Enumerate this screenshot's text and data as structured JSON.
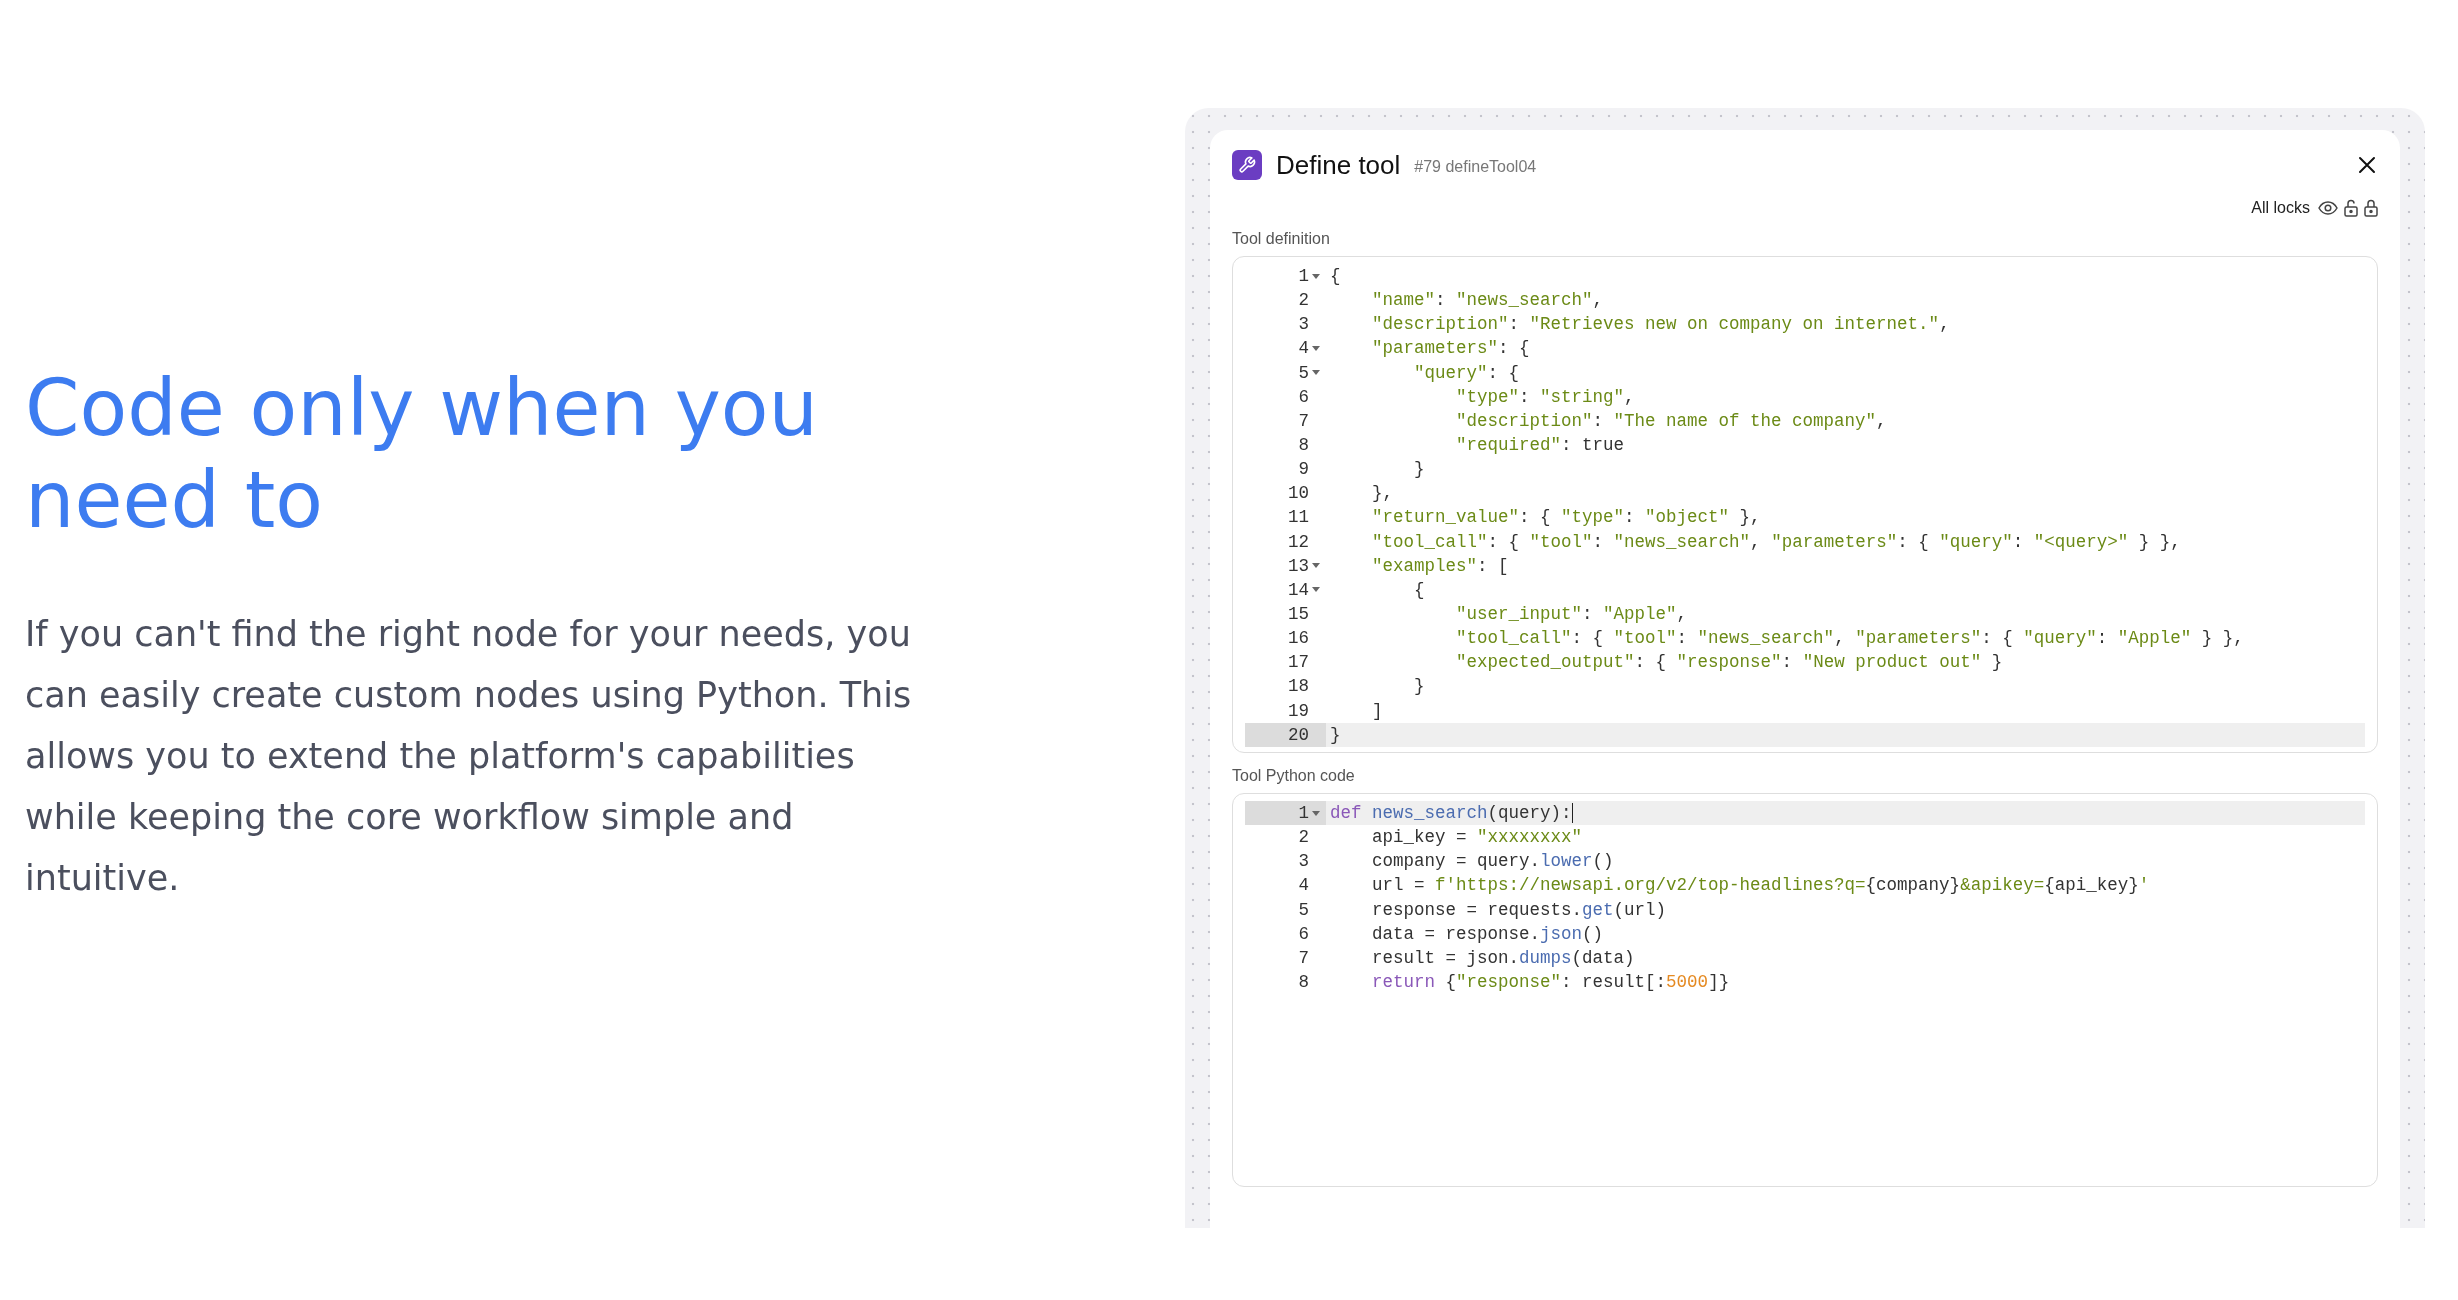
{
  "hero": {
    "heading": "Code only when you need to",
    "body": "If you can't find the right node for your needs, you can easily create custom nodes using Python. This allows you to extend the platform's capabilities while keeping the core workflow simple and intuitive."
  },
  "dialog": {
    "title": "Define tool",
    "subtitle": "#79 defineTool04",
    "locks_label": "All locks",
    "editors": [
      {
        "label": "Tool definition",
        "lines": [
          {
            "number": "1",
            "foldable": true,
            "active": false,
            "cursor": false,
            "tokens": [
              {
                "kind": "plain",
                "text": "{"
              }
            ]
          },
          {
            "number": "2",
            "foldable": false,
            "active": false,
            "cursor": false,
            "tokens": [
              {
                "kind": "string",
                "text": "    \"name\""
              },
              {
                "kind": "plain",
                "text": ": "
              },
              {
                "kind": "string",
                "text": "\"news_search\""
              },
              {
                "kind": "plain",
                "text": ","
              }
            ]
          },
          {
            "number": "3",
            "foldable": false,
            "active": false,
            "cursor": false,
            "tokens": [
              {
                "kind": "string",
                "text": "    \"description\""
              },
              {
                "kind": "plain",
                "text": ": "
              },
              {
                "kind": "string",
                "text": "\"Retrieves new on company on internet.\""
              },
              {
                "kind": "plain",
                "text": ","
              }
            ]
          },
          {
            "number": "4",
            "foldable": true,
            "active": false,
            "cursor": false,
            "tokens": [
              {
                "kind": "string",
                "text": "    \"parameters\""
              },
              {
                "kind": "plain",
                "text": ": {"
              }
            ]
          },
          {
            "number": "5",
            "foldable": true,
            "active": false,
            "cursor": false,
            "tokens": [
              {
                "kind": "string",
                "text": "        \"query\""
              },
              {
                "kind": "plain",
                "text": ": {"
              }
            ]
          },
          {
            "number": "6",
            "foldable": false,
            "active": false,
            "cursor": false,
            "tokens": [
              {
                "kind": "string",
                "text": "            \"type\""
              },
              {
                "kind": "plain",
                "text": ": "
              },
              {
                "kind": "string",
                "text": "\"string\""
              },
              {
                "kind": "plain",
                "text": ","
              }
            ]
          },
          {
            "number": "7",
            "foldable": false,
            "active": false,
            "cursor": false,
            "tokens": [
              {
                "kind": "string",
                "text": "            \"description\""
              },
              {
                "kind": "plain",
                "text": ": "
              },
              {
                "kind": "string",
                "text": "\"The name of the company\""
              },
              {
                "kind": "plain",
                "text": ","
              }
            ]
          },
          {
            "number": "8",
            "foldable": false,
            "active": false,
            "cursor": false,
            "tokens": [
              {
                "kind": "string",
                "text": "            \"required\""
              },
              {
                "kind": "plain",
                "text": ": true"
              }
            ]
          },
          {
            "number": "9",
            "foldable": false,
            "active": false,
            "cursor": false,
            "tokens": [
              {
                "kind": "plain",
                "text": "        }"
              }
            ]
          },
          {
            "number": "10",
            "foldable": false,
            "active": false,
            "cursor": false,
            "tokens": [
              {
                "kind": "plain",
                "text": "    },"
              }
            ]
          },
          {
            "number": "11",
            "foldable": false,
            "active": false,
            "cursor": false,
            "tokens": [
              {
                "kind": "string",
                "text": "    \"return_value\""
              },
              {
                "kind": "plain",
                "text": ": { "
              },
              {
                "kind": "string",
                "text": "\"type\""
              },
              {
                "kind": "plain",
                "text": ": "
              },
              {
                "kind": "string",
                "text": "\"object\""
              },
              {
                "kind": "plain",
                "text": " },"
              }
            ]
          },
          {
            "number": "12",
            "foldable": false,
            "active": false,
            "cursor": false,
            "tokens": [
              {
                "kind": "string",
                "text": "    \"tool_call\""
              },
              {
                "kind": "plain",
                "text": ": { "
              },
              {
                "kind": "string",
                "text": "\"tool\""
              },
              {
                "kind": "plain",
                "text": ": "
              },
              {
                "kind": "string",
                "text": "\"news_search\""
              },
              {
                "kind": "plain",
                "text": ", "
              },
              {
                "kind": "string",
                "text": "\"parameters\""
              },
              {
                "kind": "plain",
                "text": ": { "
              },
              {
                "kind": "string",
                "text": "\"query\""
              },
              {
                "kind": "plain",
                "text": ": "
              },
              {
                "kind": "string",
                "text": "\"<query>\""
              },
              {
                "kind": "plain",
                "text": " } },"
              }
            ]
          },
          {
            "number": "13",
            "foldable": true,
            "active": false,
            "cursor": false,
            "tokens": [
              {
                "kind": "string",
                "text": "    \"examples\""
              },
              {
                "kind": "plain",
                "text": ": ["
              }
            ]
          },
          {
            "number": "14",
            "foldable": true,
            "active": false,
            "cursor": false,
            "tokens": [
              {
                "kind": "plain",
                "text": "        {"
              }
            ]
          },
          {
            "number": "15",
            "foldable": false,
            "active": false,
            "cursor": false,
            "tokens": [
              {
                "kind": "string",
                "text": "            \"user_input\""
              },
              {
                "kind": "plain",
                "text": ": "
              },
              {
                "kind": "string",
                "text": "\"Apple\""
              },
              {
                "kind": "plain",
                "text": ","
              }
            ]
          },
          {
            "number": "16",
            "foldable": false,
            "active": false,
            "cursor": false,
            "tokens": [
              {
                "kind": "string",
                "text": "            \"tool_call\""
              },
              {
                "kind": "plain",
                "text": ": { "
              },
              {
                "kind": "string",
                "text": "\"tool\""
              },
              {
                "kind": "plain",
                "text": ": "
              },
              {
                "kind": "string",
                "text": "\"news_search\""
              },
              {
                "kind": "plain",
                "text": ", "
              },
              {
                "kind": "string",
                "text": "\"parameters\""
              },
              {
                "kind": "plain",
                "text": ": { "
              },
              {
                "kind": "string",
                "text": "\"query\""
              },
              {
                "kind": "plain",
                "text": ": "
              },
              {
                "kind": "string",
                "text": "\"Apple\""
              },
              {
                "kind": "plain",
                "text": " } },"
              }
            ]
          },
          {
            "number": "17",
            "foldable": false,
            "active": false,
            "cursor": false,
            "tokens": [
              {
                "kind": "string",
                "text": "            \"expected_output\""
              },
              {
                "kind": "plain",
                "text": ": { "
              },
              {
                "kind": "string",
                "text": "\"response\""
              },
              {
                "kind": "plain",
                "text": ": "
              },
              {
                "kind": "string",
                "text": "\"New product out\""
              },
              {
                "kind": "plain",
                "text": " }"
              }
            ]
          },
          {
            "number": "18",
            "foldable": false,
            "active": false,
            "cursor": false,
            "tokens": [
              {
                "kind": "plain",
                "text": "        }"
              }
            ]
          },
          {
            "number": "19",
            "foldable": false,
            "active": false,
            "cursor": false,
            "tokens": [
              {
                "kind": "plain",
                "text": "    ]"
              }
            ]
          },
          {
            "number": "20",
            "foldable": false,
            "active": true,
            "cursor": false,
            "tokens": [
              {
                "kind": "plain",
                "text": "}"
              }
            ]
          }
        ]
      },
      {
        "label": "Tool Python code",
        "lines": [
          {
            "number": "1",
            "foldable": true,
            "active": true,
            "cursor": true,
            "tokens": [
              {
                "kind": "keyword",
                "text": "def "
              },
              {
                "kind": "function",
                "text": "news_search"
              },
              {
                "kind": "plain",
                "text": "(query):"
              }
            ]
          },
          {
            "number": "2",
            "foldable": false,
            "active": false,
            "cursor": false,
            "tokens": [
              {
                "kind": "plain",
                "text": "    api_key = "
              },
              {
                "kind": "string",
                "text": "\"xxxxxxxx\""
              }
            ]
          },
          {
            "number": "3",
            "foldable": false,
            "active": false,
            "cursor": false,
            "tokens": [
              {
                "kind": "plain",
                "text": "    company = query."
              },
              {
                "kind": "function",
                "text": "lower"
              },
              {
                "kind": "plain",
                "text": "()"
              }
            ]
          },
          {
            "number": "4",
            "foldable": false,
            "active": false,
            "cursor": false,
            "tokens": [
              {
                "kind": "plain",
                "text": "    url = "
              },
              {
                "kind": "string",
                "text": "f'https://newsapi.org/v2/top-headlines?q="
              },
              {
                "kind": "plain",
                "text": "{company}"
              },
              {
                "kind": "string",
                "text": "&apikey="
              },
              {
                "kind": "plain",
                "text": "{api_key}"
              },
              {
                "kind": "string",
                "text": "'"
              }
            ]
          },
          {
            "number": "5",
            "foldable": false,
            "active": false,
            "cursor": false,
            "tokens": [
              {
                "kind": "plain",
                "text": "    response = requests."
              },
              {
                "kind": "function",
                "text": "get"
              },
              {
                "kind": "plain",
                "text": "(url)"
              }
            ]
          },
          {
            "number": "6",
            "foldable": false,
            "active": false,
            "cursor": false,
            "tokens": [
              {
                "kind": "plain",
                "text": "    data = response."
              },
              {
                "kind": "function",
                "text": "json"
              },
              {
                "kind": "plain",
                "text": "()"
              }
            ]
          },
          {
            "number": "7",
            "foldable": false,
            "active": false,
            "cursor": false,
            "tokens": [
              {
                "kind": "plain",
                "text": "    result = json."
              },
              {
                "kind": "function",
                "text": "dumps"
              },
              {
                "kind": "plain",
                "text": "(data)"
              }
            ]
          },
          {
            "number": "8",
            "foldable": false,
            "active": false,
            "cursor": false,
            "tokens": [
              {
                "kind": "keyword",
                "text": "    return"
              },
              {
                "kind": "plain",
                "text": " {"
              },
              {
                "kind": "string",
                "text": "\"response\""
              },
              {
                "kind": "plain",
                "text": ": result[:"
              },
              {
                "kind": "number",
                "text": "5000"
              },
              {
                "kind": "plain",
                "text": "]}"
              }
            ]
          }
        ]
      }
    ]
  }
}
